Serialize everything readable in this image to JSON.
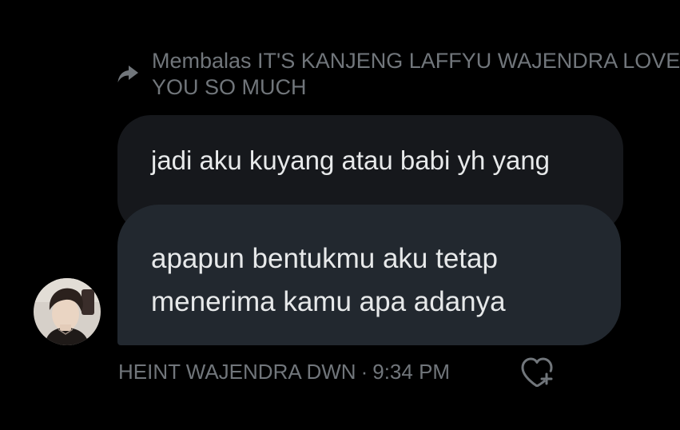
{
  "reply_header": {
    "text": "Membalas IT'S KANJENG LAFFYU WAJENDRA LOVE YOU SO MUCH",
    "icon": "reply-arrow-icon"
  },
  "quoted_message": {
    "text": "jadi aku kuyang atau babi yh yang"
  },
  "reply_message": {
    "text": "apapun bentukmu aku tetap menerima kamu apa adanya"
  },
  "meta": {
    "sender": "HEINT WAJENDRA DWN",
    "separator": "·",
    "time": "9:34 PM"
  },
  "icons": {
    "reaction": "heart-add-icon",
    "avatar": "avatar"
  },
  "colors": {
    "background": "#000000",
    "bubble_quoted": "#16181c",
    "bubble_reply": "#22282f",
    "text_primary": "#e7e9ea",
    "text_secondary": "#71767b"
  }
}
